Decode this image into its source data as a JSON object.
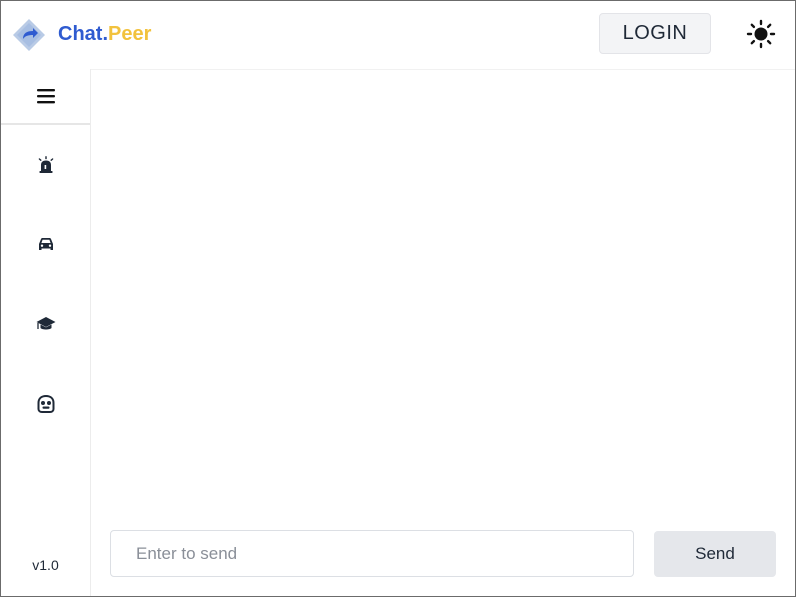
{
  "header": {
    "brand_part1": "Chat",
    "brand_dot": ".",
    "brand_part2": "Peer",
    "login_label": "LOGIN",
    "theme_icon": "sun-icon",
    "logo_icon": "share-diamond-logo"
  },
  "sidebar": {
    "menu_icon": "hamburger-menu-icon",
    "items": [
      {
        "icon": "siren-icon"
      },
      {
        "icon": "car-icon"
      },
      {
        "icon": "graduation-cap-icon"
      },
      {
        "icon": "robot-icon"
      }
    ],
    "version": "v1.0"
  },
  "composer": {
    "placeholder": "Enter to send",
    "value": "",
    "send_label": "Send"
  },
  "colors": {
    "brand_blue": "#2f5bd0",
    "brand_yellow": "#f2c23d",
    "button_gray": "#e5e7eb",
    "text_dark": "#1f2937"
  }
}
